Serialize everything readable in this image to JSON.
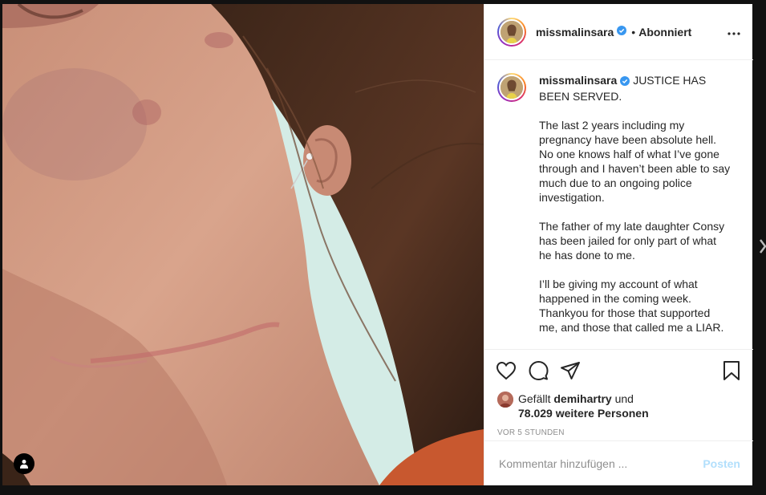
{
  "post": {
    "username": "missmalinsara",
    "follow_status": "Abonniert",
    "separator": "•",
    "caption_username": "missmalinsara",
    "caption_paragraphs": [
      "JUSTICE HAS BEEN SERVED.",
      "The last 2 years including my pregnancy have been absolute hell. No one knows half of what I’ve gone through and I haven’t been able to say much due to an ongoing police investigation.",
      "The father of my late daughter Consy has been jailed for only part of what he has done to me.",
      "I’ll be giving my account of what happened in the coming week. Thankyou for those that supported me, and those that called me a LIAR."
    ],
    "likes_prefix": "Gefällt",
    "likes_user": "demihartry",
    "likes_mid": "und",
    "likes_count": "78.029 weitere Personen",
    "timestamp": "VOR 5 STUNDEN",
    "comment_placeholder": "Kommentar hinzufügen ...",
    "post_button": "Posten"
  },
  "icons": {
    "like": "heart-icon",
    "comment": "comment-icon",
    "share": "share-icon",
    "save": "bookmark-icon",
    "more": "more-icon",
    "verified": "verified-badge-icon",
    "user_tag": "user-tag-icon",
    "next": "chevron-right-icon"
  },
  "colors": {
    "verified": "#3897f0",
    "post_button_disabled": "#b2dffc",
    "muted": "#8e8e8e"
  }
}
